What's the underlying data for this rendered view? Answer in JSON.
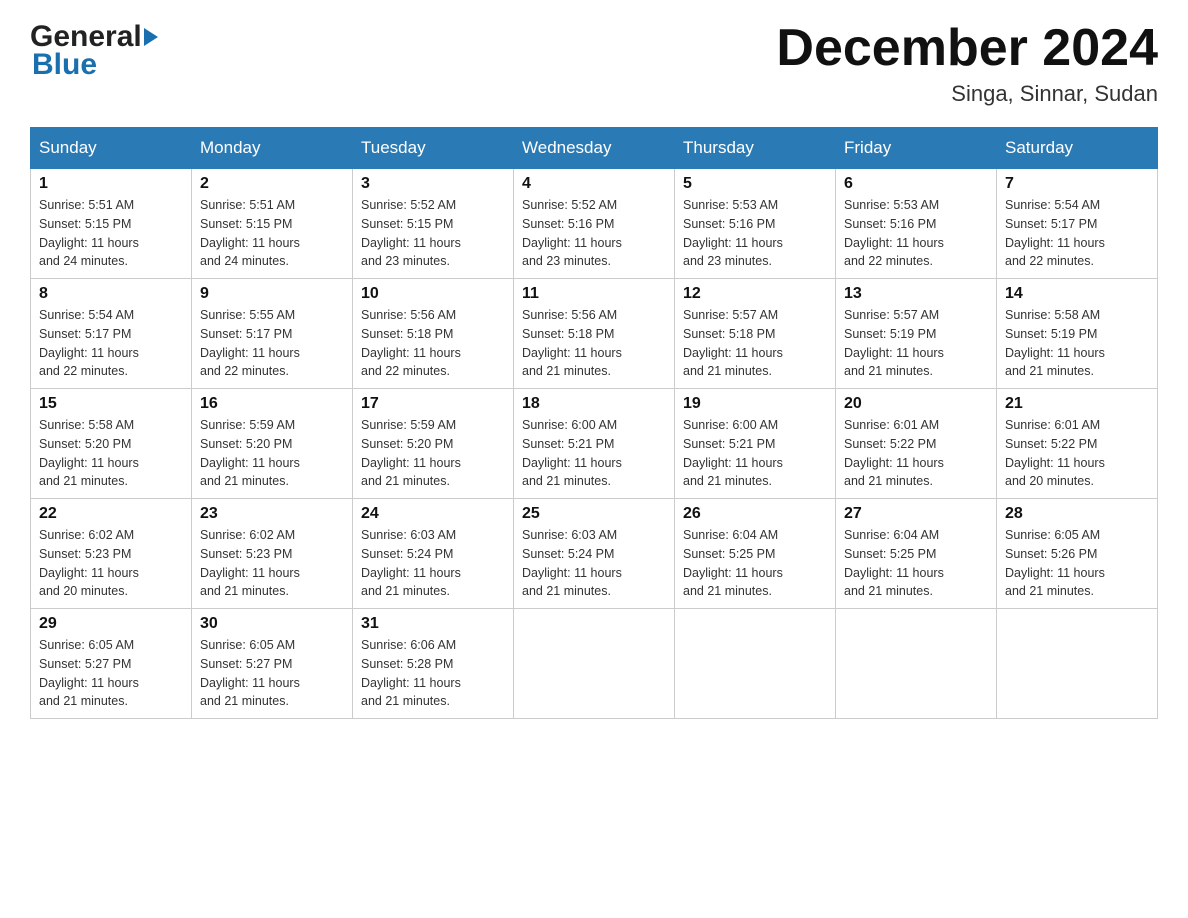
{
  "header": {
    "logo_general": "General",
    "logo_blue": "Blue",
    "title": "December 2024",
    "subtitle": "Singa, Sinnar, Sudan"
  },
  "calendar": {
    "days_of_week": [
      "Sunday",
      "Monday",
      "Tuesday",
      "Wednesday",
      "Thursday",
      "Friday",
      "Saturday"
    ],
    "weeks": [
      [
        {
          "day": "1",
          "sunrise": "5:51 AM",
          "sunset": "5:15 PM",
          "daylight": "11 hours and 24 minutes."
        },
        {
          "day": "2",
          "sunrise": "5:51 AM",
          "sunset": "5:15 PM",
          "daylight": "11 hours and 24 minutes."
        },
        {
          "day": "3",
          "sunrise": "5:52 AM",
          "sunset": "5:15 PM",
          "daylight": "11 hours and 23 minutes."
        },
        {
          "day": "4",
          "sunrise": "5:52 AM",
          "sunset": "5:16 PM",
          "daylight": "11 hours and 23 minutes."
        },
        {
          "day": "5",
          "sunrise": "5:53 AM",
          "sunset": "5:16 PM",
          "daylight": "11 hours and 23 minutes."
        },
        {
          "day": "6",
          "sunrise": "5:53 AM",
          "sunset": "5:16 PM",
          "daylight": "11 hours and 22 minutes."
        },
        {
          "day": "7",
          "sunrise": "5:54 AM",
          "sunset": "5:17 PM",
          "daylight": "11 hours and 22 minutes."
        }
      ],
      [
        {
          "day": "8",
          "sunrise": "5:54 AM",
          "sunset": "5:17 PM",
          "daylight": "11 hours and 22 minutes."
        },
        {
          "day": "9",
          "sunrise": "5:55 AM",
          "sunset": "5:17 PM",
          "daylight": "11 hours and 22 minutes."
        },
        {
          "day": "10",
          "sunrise": "5:56 AM",
          "sunset": "5:18 PM",
          "daylight": "11 hours and 22 minutes."
        },
        {
          "day": "11",
          "sunrise": "5:56 AM",
          "sunset": "5:18 PM",
          "daylight": "11 hours and 21 minutes."
        },
        {
          "day": "12",
          "sunrise": "5:57 AM",
          "sunset": "5:18 PM",
          "daylight": "11 hours and 21 minutes."
        },
        {
          "day": "13",
          "sunrise": "5:57 AM",
          "sunset": "5:19 PM",
          "daylight": "11 hours and 21 minutes."
        },
        {
          "day": "14",
          "sunrise": "5:58 AM",
          "sunset": "5:19 PM",
          "daylight": "11 hours and 21 minutes."
        }
      ],
      [
        {
          "day": "15",
          "sunrise": "5:58 AM",
          "sunset": "5:20 PM",
          "daylight": "11 hours and 21 minutes."
        },
        {
          "day": "16",
          "sunrise": "5:59 AM",
          "sunset": "5:20 PM",
          "daylight": "11 hours and 21 minutes."
        },
        {
          "day": "17",
          "sunrise": "5:59 AM",
          "sunset": "5:20 PM",
          "daylight": "11 hours and 21 minutes."
        },
        {
          "day": "18",
          "sunrise": "6:00 AM",
          "sunset": "5:21 PM",
          "daylight": "11 hours and 21 minutes."
        },
        {
          "day": "19",
          "sunrise": "6:00 AM",
          "sunset": "5:21 PM",
          "daylight": "11 hours and 21 minutes."
        },
        {
          "day": "20",
          "sunrise": "6:01 AM",
          "sunset": "5:22 PM",
          "daylight": "11 hours and 21 minutes."
        },
        {
          "day": "21",
          "sunrise": "6:01 AM",
          "sunset": "5:22 PM",
          "daylight": "11 hours and 20 minutes."
        }
      ],
      [
        {
          "day": "22",
          "sunrise": "6:02 AM",
          "sunset": "5:23 PM",
          "daylight": "11 hours and 20 minutes."
        },
        {
          "day": "23",
          "sunrise": "6:02 AM",
          "sunset": "5:23 PM",
          "daylight": "11 hours and 21 minutes."
        },
        {
          "day": "24",
          "sunrise": "6:03 AM",
          "sunset": "5:24 PM",
          "daylight": "11 hours and 21 minutes."
        },
        {
          "day": "25",
          "sunrise": "6:03 AM",
          "sunset": "5:24 PM",
          "daylight": "11 hours and 21 minutes."
        },
        {
          "day": "26",
          "sunrise": "6:04 AM",
          "sunset": "5:25 PM",
          "daylight": "11 hours and 21 minutes."
        },
        {
          "day": "27",
          "sunrise": "6:04 AM",
          "sunset": "5:25 PM",
          "daylight": "11 hours and 21 minutes."
        },
        {
          "day": "28",
          "sunrise": "6:05 AM",
          "sunset": "5:26 PM",
          "daylight": "11 hours and 21 minutes."
        }
      ],
      [
        {
          "day": "29",
          "sunrise": "6:05 AM",
          "sunset": "5:27 PM",
          "daylight": "11 hours and 21 minutes."
        },
        {
          "day": "30",
          "sunrise": "6:05 AM",
          "sunset": "5:27 PM",
          "daylight": "11 hours and 21 minutes."
        },
        {
          "day": "31",
          "sunrise": "6:06 AM",
          "sunset": "5:28 PM",
          "daylight": "11 hours and 21 minutes."
        },
        null,
        null,
        null,
        null
      ]
    ],
    "sunrise_label": "Sunrise:",
    "sunset_label": "Sunset:",
    "daylight_label": "Daylight:"
  }
}
